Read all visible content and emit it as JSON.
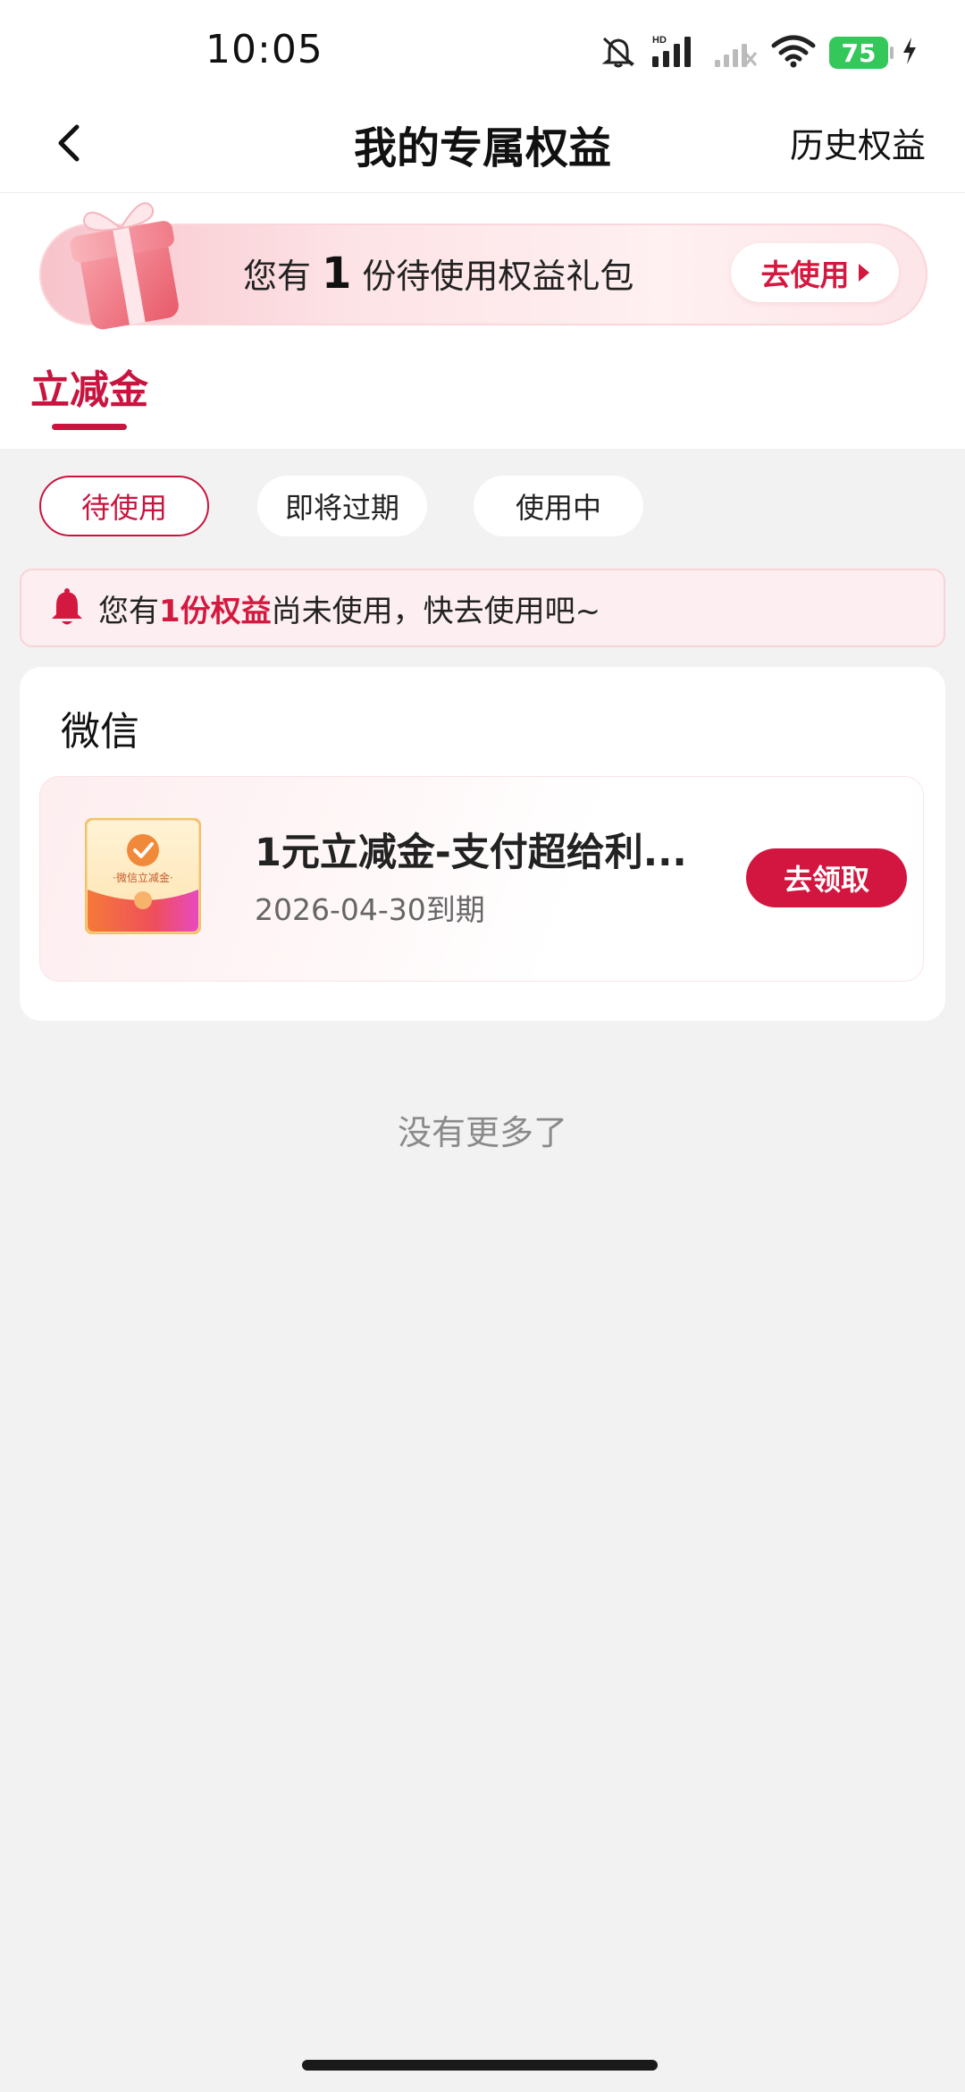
{
  "status_bar": {
    "time": "10:05",
    "network_label": "HD",
    "battery": "75",
    "icons": [
      "mute-icon",
      "signal-icon",
      "signal-2-icon",
      "wifi-icon",
      "battery-icon",
      "charging-icon"
    ]
  },
  "nav": {
    "title": "我的专属权益",
    "right_link": "历史权益",
    "back_icon": "chevron-left-icon"
  },
  "banner": {
    "prefix": "您有",
    "count": "1",
    "suffix": "份待使用权益礼包",
    "button_label": "去使用",
    "icon": "gift-icon"
  },
  "main_tab": {
    "label": "立减金"
  },
  "filters": [
    {
      "label": "待使用",
      "active": true
    },
    {
      "label": "即将过期",
      "active": false
    },
    {
      "label": "使用中",
      "active": false
    }
  ],
  "notice": {
    "prefix": "您有",
    "highlight": "1份权益",
    "suffix": "尚未使用，快去使用吧~",
    "icon": "bell-icon"
  },
  "card": {
    "title": "微信",
    "coupon": {
      "name": "1元立减金-支付超给利...",
      "expiry": "2026-04-30到期",
      "image_caption": "·微信立减金·",
      "button_label": "去领取"
    }
  },
  "footer": {
    "no_more": "没有更多了"
  },
  "colors": {
    "accent": "#c8143f",
    "button_red": "#d3163f",
    "background": "#f2f2f2",
    "battery_green": "#34c759"
  }
}
